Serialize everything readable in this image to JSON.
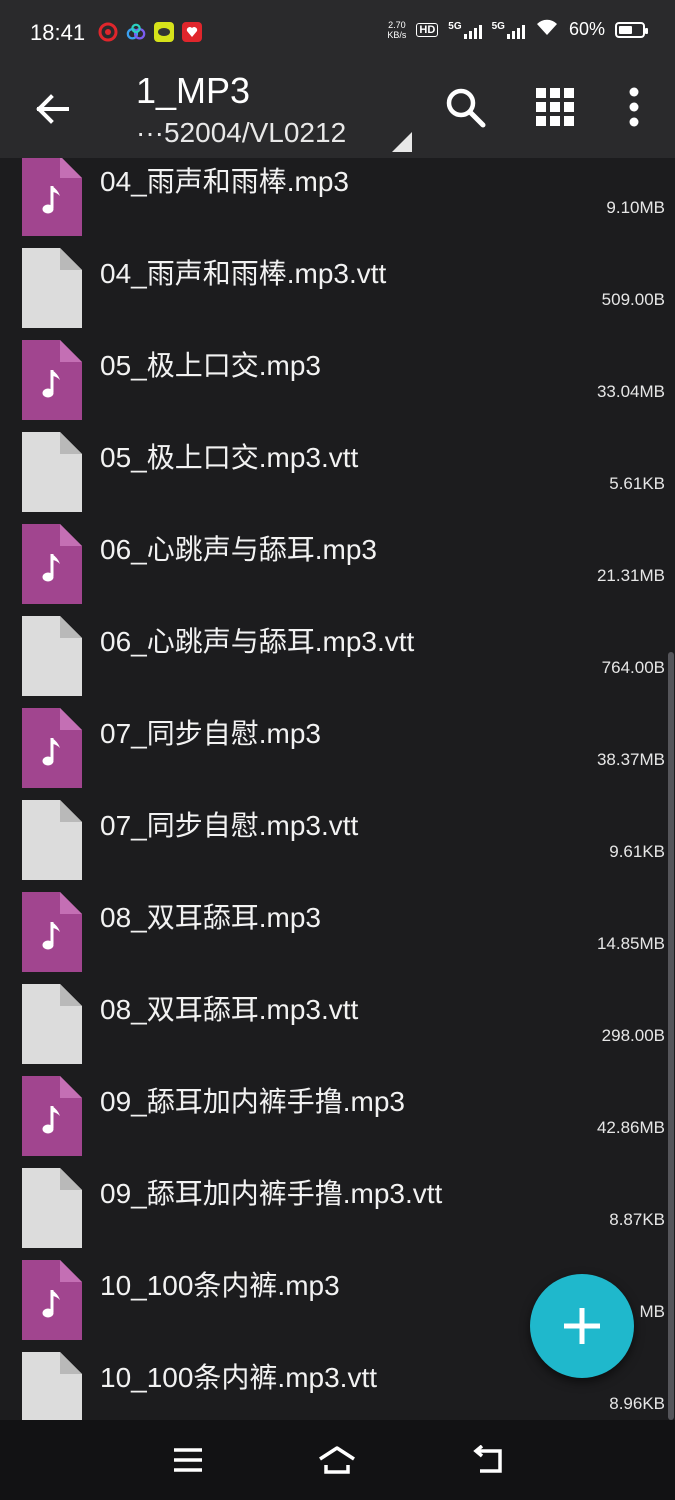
{
  "status_bar": {
    "time": "18:41",
    "net_speed_value": "2.70",
    "net_speed_unit": "KB/s",
    "hd_label": "HD",
    "sim1_label": "5G",
    "sim2_label": "5G",
    "battery_percent": "60%",
    "battery_level": 0.6
  },
  "app_bar": {
    "title": "1_MP3",
    "path": "···52004/VL0212"
  },
  "colors": {
    "audio_icon": "#a1458f",
    "generic_icon": "#dcdcdc",
    "fab": "#1fb8cc",
    "background": "#1c1c1e"
  },
  "files": [
    {
      "name": "04_雨声和雨棒.mp3",
      "size": "9.10MB",
      "icon": "audio-file-icon"
    },
    {
      "name": "04_雨声和雨棒.mp3.vtt",
      "size": "509.00B",
      "icon": "generic-file-icon"
    },
    {
      "name": "05_极上口交.mp3",
      "size": "33.04MB",
      "icon": "audio-file-icon"
    },
    {
      "name": "05_极上口交.mp3.vtt",
      "size": "5.61KB",
      "icon": "generic-file-icon"
    },
    {
      "name": "06_心跳声与舔耳.mp3",
      "size": "21.31MB",
      "icon": "audio-file-icon"
    },
    {
      "name": "06_心跳声与舔耳.mp3.vtt",
      "size": "764.00B",
      "icon": "generic-file-icon"
    },
    {
      "name": "07_同步自慰.mp3",
      "size": "38.37MB",
      "icon": "audio-file-icon"
    },
    {
      "name": "07_同步自慰.mp3.vtt",
      "size": "9.61KB",
      "icon": "generic-file-icon"
    },
    {
      "name": "08_双耳舔耳.mp3",
      "size": "14.85MB",
      "icon": "audio-file-icon"
    },
    {
      "name": "08_双耳舔耳.mp3.vtt",
      "size": "298.00B",
      "icon": "generic-file-icon"
    },
    {
      "name": "09_舔耳加内裤手撸.mp3",
      "size": "42.86MB",
      "icon": "audio-file-icon"
    },
    {
      "name": "09_舔耳加内裤手撸.mp3.vtt",
      "size": "8.87KB",
      "icon": "generic-file-icon"
    },
    {
      "name": "10_100条内裤.mp3",
      "size": "MB",
      "icon": "audio-file-icon"
    },
    {
      "name": "10_100条内裤.mp3.vtt",
      "size": "8.96KB",
      "icon": "generic-file-icon"
    }
  ]
}
